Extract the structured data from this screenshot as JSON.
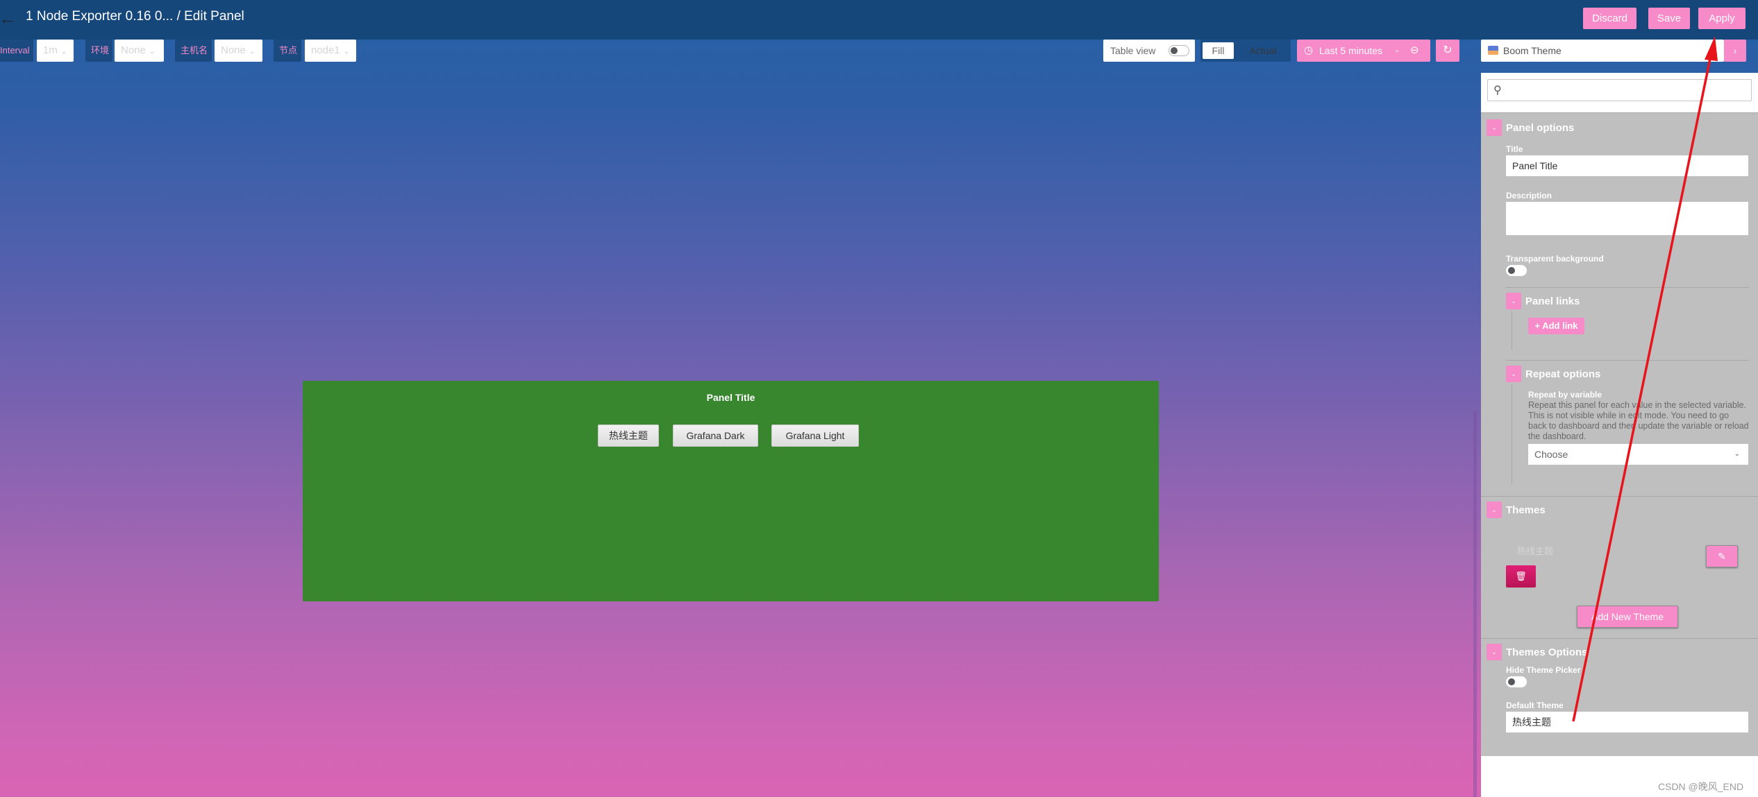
{
  "header": {
    "title": "1 Node Exporter 0.16 0... / Edit Panel",
    "discard_label": "Discard",
    "save_label": "Save",
    "apply_label": "Apply"
  },
  "variables": [
    {
      "label": "Interval",
      "value": "1m"
    },
    {
      "label": "环境",
      "value": "None"
    },
    {
      "label": "主机名",
      "value": "None"
    },
    {
      "label": "节点",
      "value": "node1"
    }
  ],
  "toolbar": {
    "table_view_label": "Table view",
    "table_view_on": false,
    "fill_label": "Fill",
    "actual_label": "Actual",
    "time_range_label": "Last 5 minutes",
    "theme_picker_value": "Boom Theme"
  },
  "icons": {
    "back": "←",
    "chevron_down": "⌄",
    "clock": "◷",
    "zoom_out": "⊖",
    "refresh": "↻",
    "chevron_right": "›",
    "search": "⚲",
    "plus": "+",
    "edit": "✎",
    "trash": "🗑"
  },
  "panel": {
    "title": "Panel Title",
    "theme_buttons": [
      "热线主题",
      "Grafana Dark",
      "Grafana Light"
    ],
    "background_color": "#38872f"
  },
  "options": {
    "search_placeholder": "",
    "panel_options": {
      "section_title": "Panel options",
      "title_label": "Title",
      "title_value": "Panel Title",
      "description_label": "Description",
      "description_value": "",
      "transparent_label": "Transparent background",
      "transparent_on": false
    },
    "panel_links": {
      "section_title": "Panel links",
      "add_link_label": "Add link"
    },
    "repeat_options": {
      "section_title": "Repeat options",
      "repeat_label": "Repeat by variable",
      "repeat_help": "Repeat this panel for each value in the selected variable. This is not visible while in edit mode. You need to go back to dashboard and then update the variable or reload the dashboard.",
      "repeat_select_value": "Choose"
    },
    "themes": {
      "section_title": "Themes",
      "items": [
        {
          "name": "热线主题"
        }
      ],
      "add_theme_label": "Add New Theme"
    },
    "themes_options": {
      "section_title": "Themes Options",
      "hide_picker_label": "Hide Theme Picker",
      "hide_picker_on": false,
      "default_theme_label": "Default Theme",
      "default_theme_value": "热线主题"
    }
  },
  "colors": {
    "accent_pink": "#f78ac8",
    "danger": "#d81b60",
    "header_bg": "#16477a",
    "options_bg": "#bfbfbf",
    "annotation_arrow": "#e8141c"
  },
  "watermark": "CSDN @晚风_END"
}
